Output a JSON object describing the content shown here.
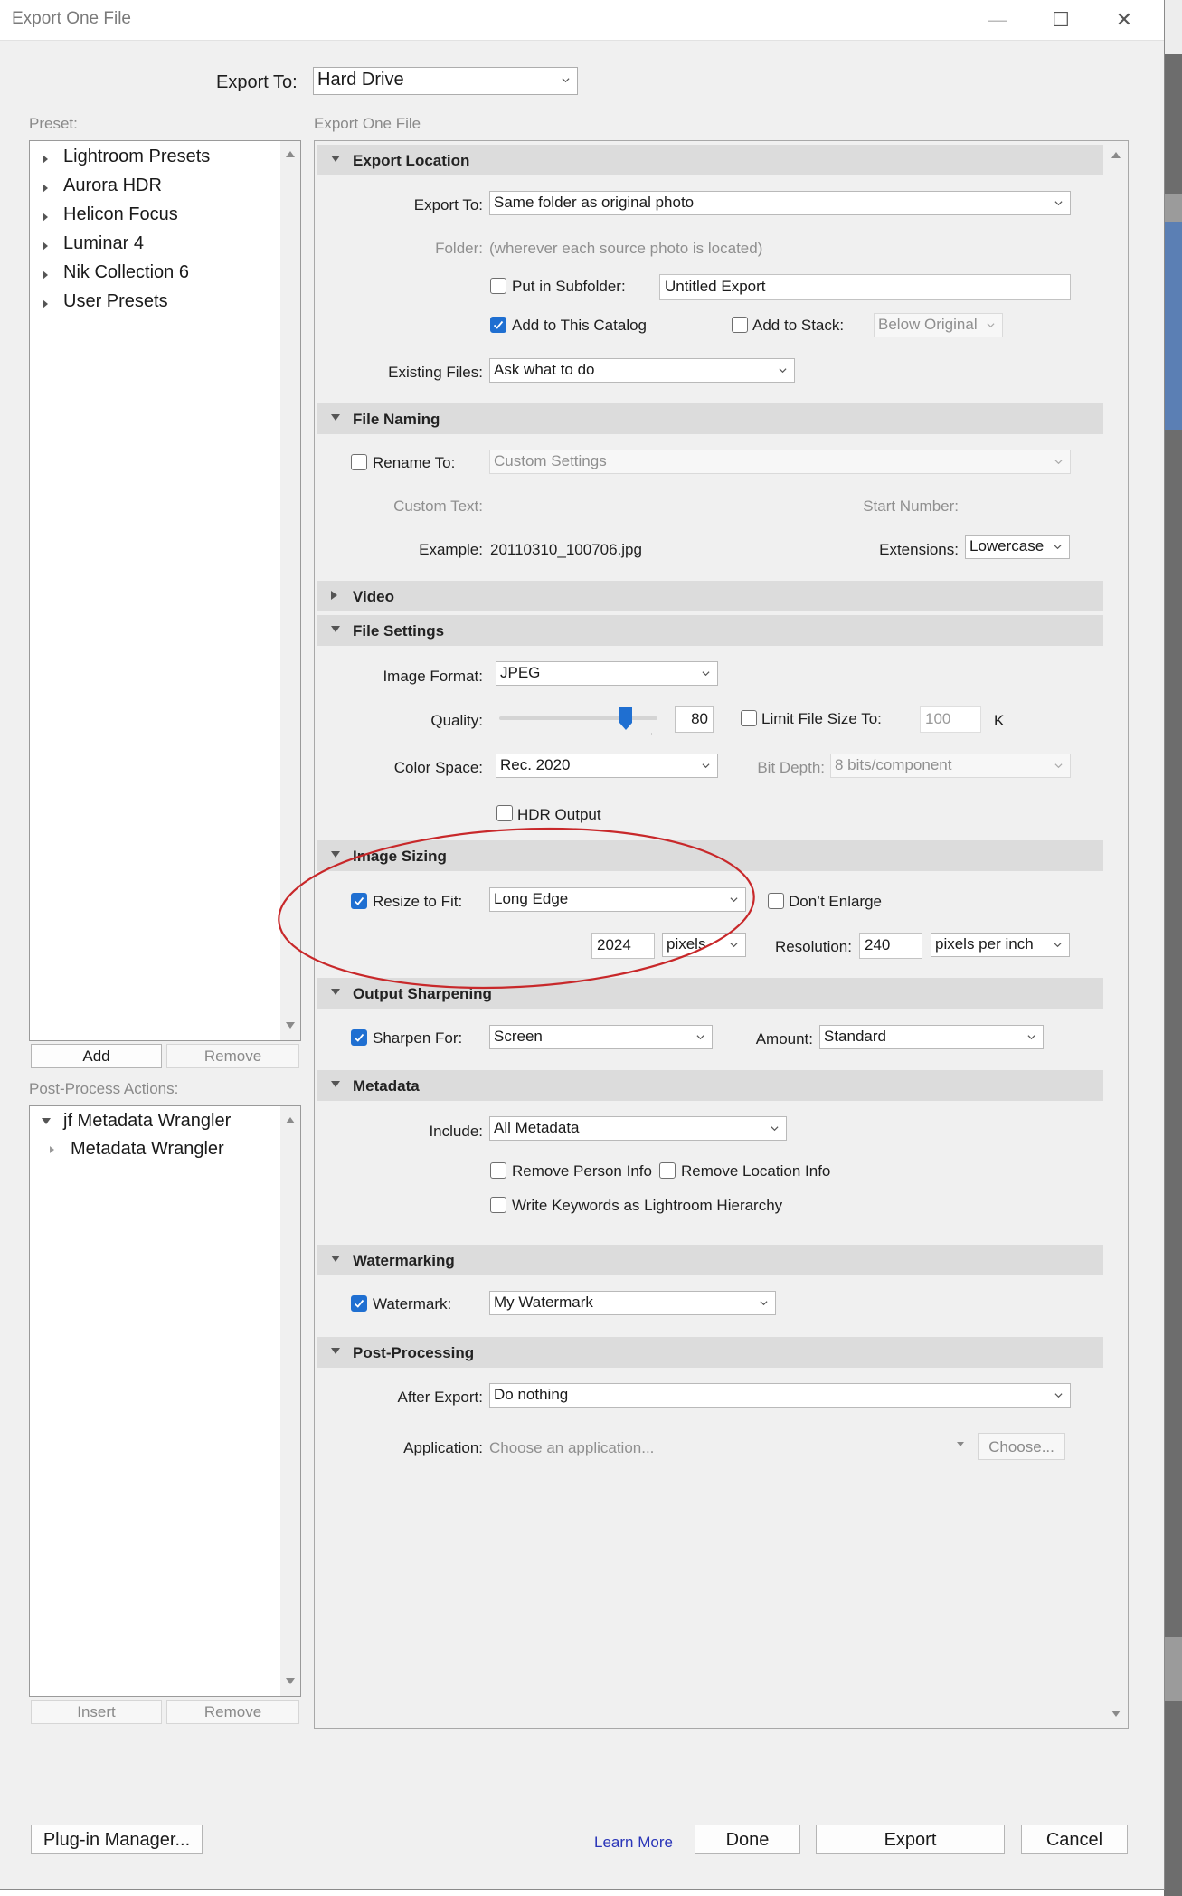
{
  "window": {
    "title": "Export One File",
    "minimize_glyph": "—",
    "maximize_glyph": "☐",
    "close_glyph": "✕"
  },
  "export_to": {
    "label": "Export To:",
    "value": "Hard Drive"
  },
  "preset": {
    "heading": "Preset:",
    "items": [
      "Lightroom Presets",
      "Aurora HDR",
      "Helicon Focus",
      "Luminar 4",
      "Nik Collection 6",
      "User Presets"
    ],
    "add_button": "Add",
    "remove_button": "Remove"
  },
  "post_process_actions": {
    "heading": "Post-Process Actions:",
    "group": "jf Metadata Wrangler",
    "child": "Metadata Wrangler",
    "insert_button": "Insert",
    "remove_button": "Remove"
  },
  "right_heading": "Export One File",
  "sections": {
    "export_location": {
      "title": "Export Location",
      "export_to_label": "Export To:",
      "export_to_value": "Same folder as original photo",
      "folder_label": "Folder:",
      "folder_value": "(wherever each source photo is located)",
      "put_in_subfolder_label": "Put in Subfolder:",
      "put_in_subfolder_checked": false,
      "subfolder_value": "Untitled Export",
      "add_to_catalog_label": "Add to This Catalog",
      "add_to_catalog_checked": true,
      "add_to_stack_label": "Add to Stack:",
      "add_to_stack_checked": false,
      "stack_value": "Below Original",
      "existing_files_label": "Existing Files:",
      "existing_files_value": "Ask what to do"
    },
    "file_naming": {
      "title": "File Naming",
      "rename_to_label": "Rename To:",
      "rename_to_checked": false,
      "rename_value": "Custom Settings",
      "custom_text_label": "Custom Text:",
      "start_number_label": "Start Number:",
      "example_label": "Example:",
      "example_value": "20110310_100706.jpg",
      "extensions_label": "Extensions:",
      "extensions_value": "Lowercase"
    },
    "video": {
      "title": "Video"
    },
    "file_settings": {
      "title": "File Settings",
      "image_format_label": "Image Format:",
      "image_format_value": "JPEG",
      "quality_label": "Quality:",
      "quality_value": "80",
      "quality_fraction": 0.8,
      "limit_file_size_label": "Limit File Size To:",
      "limit_file_size_checked": false,
      "limit_value": "100",
      "limit_unit": "K",
      "color_space_label": "Color Space:",
      "color_space_value": "Rec. 2020",
      "bit_depth_label": "Bit Depth:",
      "bit_depth_value": "8 bits/component",
      "hdr_output_label": "HDR Output",
      "hdr_output_checked": false
    },
    "image_sizing": {
      "title": "Image Sizing",
      "resize_label": "Resize to Fit:",
      "resize_checked": true,
      "resize_value": "Long Edge",
      "dont_enlarge_label": "Don’t Enlarge",
      "dont_enlarge_checked": false,
      "size_value": "2024",
      "size_unit": "pixels",
      "resolution_label": "Resolution:",
      "resolution_value": "240",
      "resolution_unit": "pixels per inch"
    },
    "output_sharpening": {
      "title": "Output Sharpening",
      "sharpen_for_label": "Sharpen For:",
      "sharpen_for_checked": true,
      "sharpen_for_value": "Screen",
      "amount_label": "Amount:",
      "amount_value": "Standard"
    },
    "metadata": {
      "title": "Metadata",
      "include_label": "Include:",
      "include_value": "All Metadata",
      "remove_person_label": "Remove Person Info",
      "remove_person_checked": false,
      "remove_location_label": "Remove Location Info",
      "remove_location_checked": false,
      "write_keywords_label": "Write Keywords as Lightroom Hierarchy",
      "write_keywords_checked": false
    },
    "watermarking": {
      "title": "Watermarking",
      "watermark_label": "Watermark:",
      "watermark_checked": true,
      "watermark_value": "My Watermark"
    },
    "post_processing": {
      "title": "Post-Processing",
      "after_export_label": "After Export:",
      "after_export_value": "Do nothing",
      "application_label": "Application:",
      "application_placeholder": "Choose an application...",
      "choose_button": "Choose..."
    }
  },
  "footer": {
    "plugin_manager": "Plug-in Manager...",
    "learn_more": "Learn More",
    "done": "Done",
    "export": "Export",
    "cancel": "Cancel"
  },
  "colors": {
    "accent": "#1f6fd1",
    "annotation": "#c8282a",
    "section_bg": "#dcdcdc",
    "window_bg": "#f0f0f0"
  }
}
